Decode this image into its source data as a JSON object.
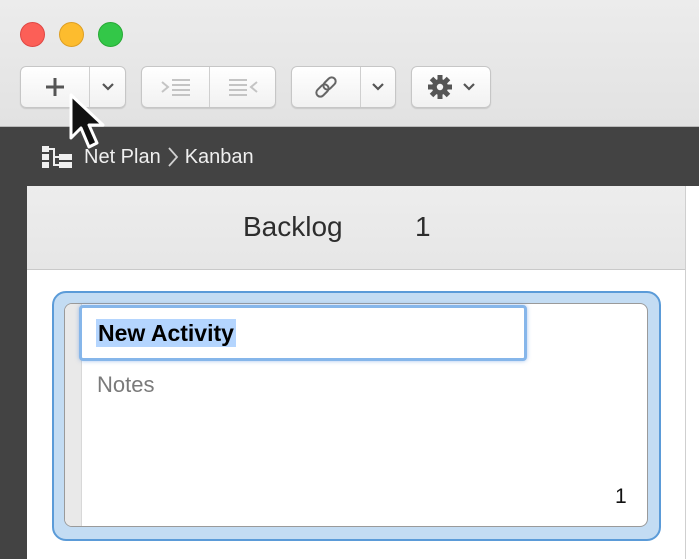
{
  "window": {
    "traffic_lights": {
      "close_color": "#fc5f57",
      "minimize_color": "#fdbc2e",
      "maximize_color": "#33c748"
    }
  },
  "toolbar": {
    "add_icon": "plus-icon",
    "add_menu_icon": "chevron-down-icon",
    "indent_icon": "indent-icon",
    "outdent_icon": "outdent-icon",
    "link_icon": "paperclip-link-icon",
    "link_menu_icon": "chevron-down-icon",
    "settings_icon": "gear-icon",
    "settings_menu_icon": "chevron-down-icon"
  },
  "breadcrumb": {
    "icon": "hierarchy-icon",
    "items": [
      "Net Plan",
      "Kanban"
    ]
  },
  "board": {
    "columns": [
      {
        "title": "Backlog",
        "count": "1"
      }
    ]
  },
  "card": {
    "title": "New Activity",
    "notes_placeholder": "Notes",
    "count": "1",
    "highlight_color": "#5b9bd8"
  }
}
